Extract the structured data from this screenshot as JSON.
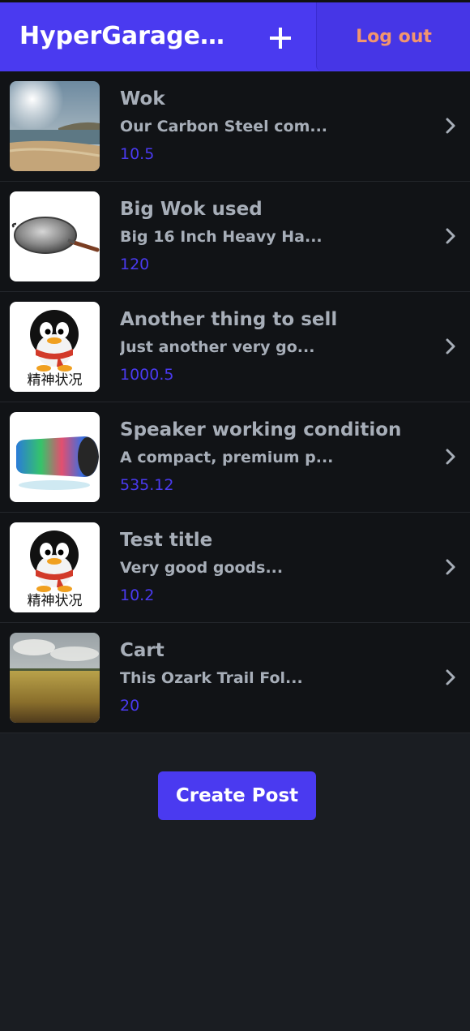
{
  "header": {
    "title": "HyperGarage…",
    "add_icon": "plus-icon",
    "logout_label": "Log out",
    "colors": {
      "bar": "#4a3af0",
      "logout_text": "#f2956e"
    }
  },
  "posts": [
    {
      "title": "Wok",
      "description": "Our Carbon Steel com...",
      "price": "10.5",
      "image": "beach-photo"
    },
    {
      "title": "Big Wok used",
      "description": "Big 16 Inch Heavy Ha...",
      "price": "120",
      "image": "wok-photo"
    },
    {
      "title": "Another thing to sell",
      "description": "Just another very go...",
      "price": "1000.5",
      "image": "penguin-sticker",
      "image_caption": "精神状况"
    },
    {
      "title": "Speaker working condition",
      "description": "A compact, premium p...",
      "price": "535.12",
      "image": "speaker-photo"
    },
    {
      "title": "Test title",
      "description": "Very good goods...",
      "price": "10.2",
      "image": "penguin-sticker",
      "image_caption": "精神状况"
    },
    {
      "title": "Cart",
      "description": "This Ozark Trail Fol...",
      "price": "20",
      "image": "field-photo"
    }
  ],
  "create_post_label": "Create Post"
}
